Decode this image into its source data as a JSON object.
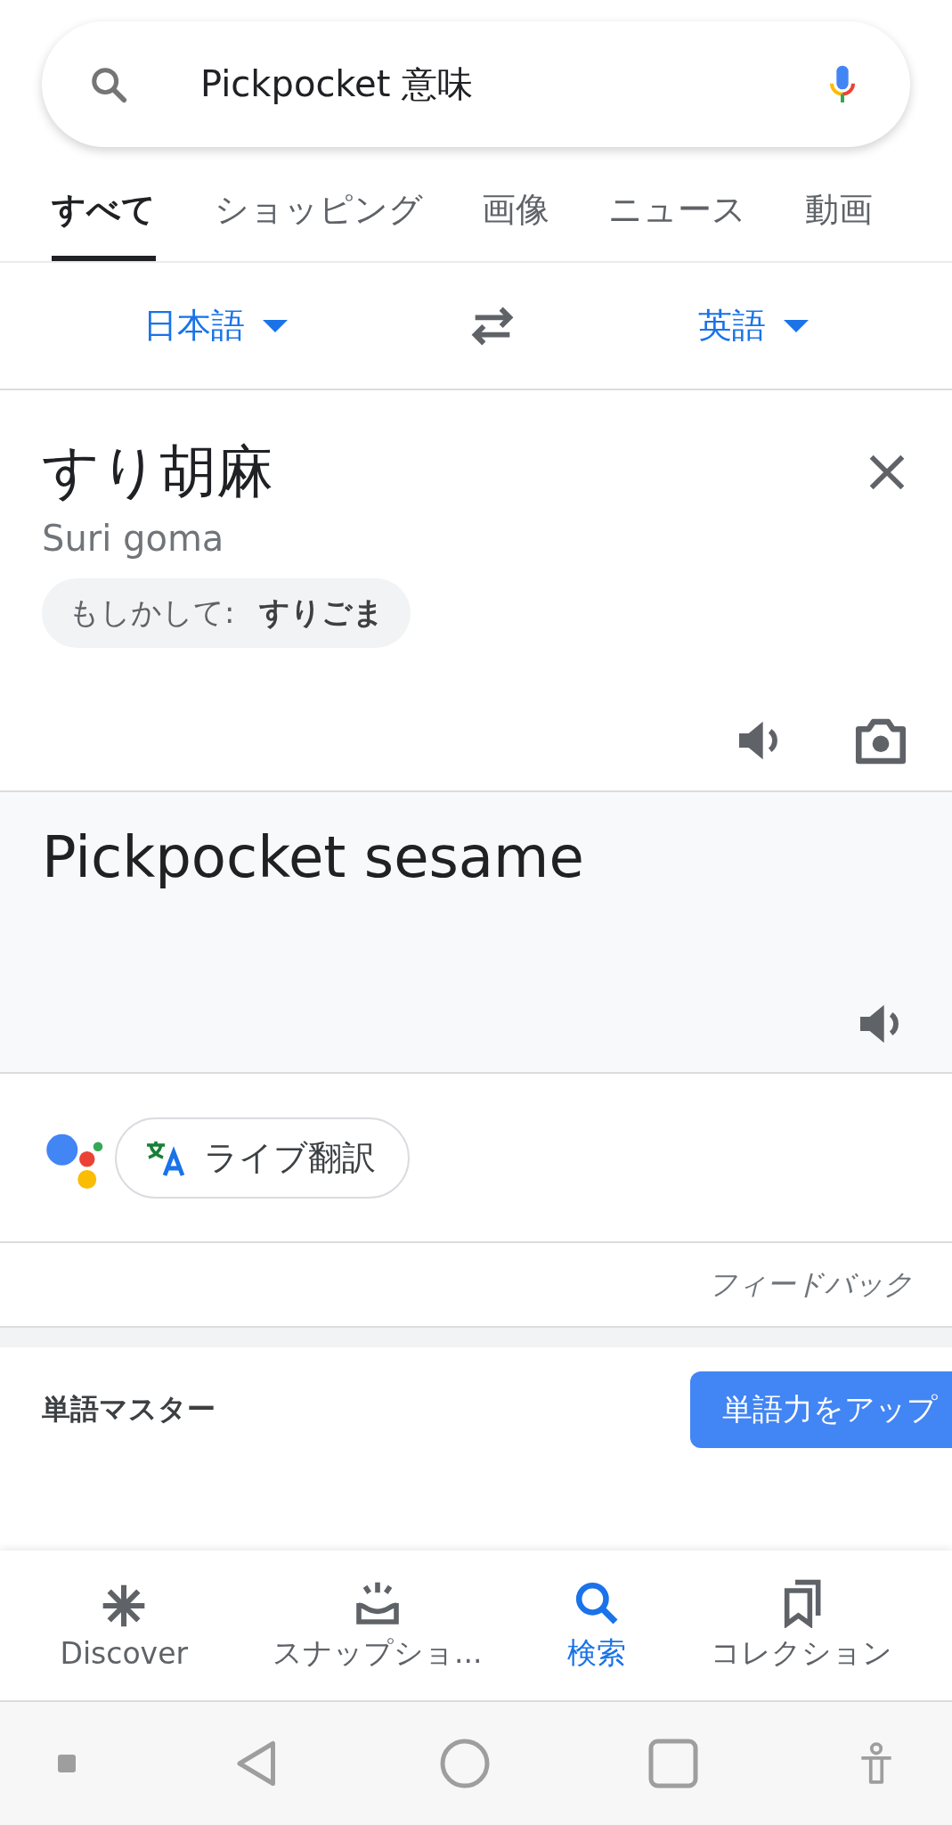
{
  "search": {
    "query": "Pickpocket 意味"
  },
  "tabs": [
    {
      "label": "すべて",
      "selected": true
    },
    {
      "label": "ショッピング",
      "selected": false
    },
    {
      "label": "画像",
      "selected": false
    },
    {
      "label": "ニュース",
      "selected": false
    },
    {
      "label": "動画",
      "selected": false
    }
  ],
  "languages": {
    "source": "日本語",
    "target": "英語"
  },
  "source": {
    "text": "すり胡麻",
    "romanization": "Suri goma",
    "suggestion_label": "もしかして:",
    "suggestion": "すりごま"
  },
  "result": {
    "text": "Pickpocket sesame"
  },
  "live_translate": {
    "label": "ライブ翻訳"
  },
  "feedback": "フィードバック",
  "vocab": {
    "title": "単語マスター",
    "button": "単語力をアップ"
  },
  "bottom_nav": [
    {
      "label": "Discover",
      "kind": "asterisk",
      "selected": false
    },
    {
      "label": "スナップショ...",
      "kind": "snapshot",
      "selected": false
    },
    {
      "label": "検索",
      "kind": "search",
      "selected": true
    },
    {
      "label": "コレクション",
      "kind": "bookmarks",
      "selected": false
    }
  ]
}
